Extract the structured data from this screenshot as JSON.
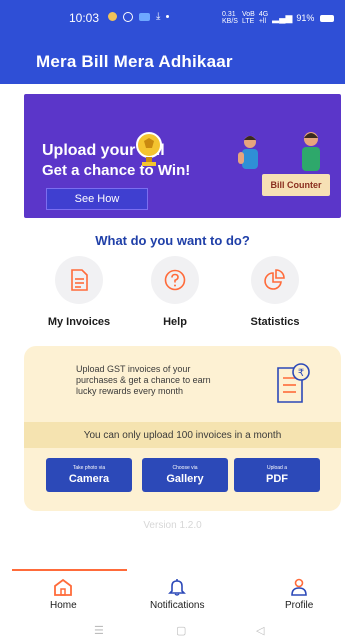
{
  "status_bar": {
    "time": "10:03",
    "network_speed": "0.31\nKB/S",
    "network_type": "VoB\nLTE",
    "signal": "4G\n+ll",
    "battery": "91%"
  },
  "app_bar": {
    "title": "Mera Bill Mera Adhikaar"
  },
  "banner": {
    "line1": "Upload your Bill",
    "line2": "Get a chance to Win!",
    "cta_label": "See How",
    "counter_label": "Bill Counter"
  },
  "section": {
    "question": "What do you want to do?"
  },
  "actions": [
    {
      "label": "My Invoices",
      "icon": "invoice-icon"
    },
    {
      "label": "Help",
      "icon": "help-icon"
    },
    {
      "label": "Statistics",
      "icon": "pie-chart-icon"
    }
  ],
  "upload_card": {
    "description": "Upload GST invoices of your purchases & get a chance to earn lucky rewards every month",
    "limit_text": "You can only upload 100 invoices in a month",
    "buttons": [
      {
        "small": "Take photo via",
        "big": "Camera"
      },
      {
        "small": "Choose via",
        "big": "Gallery"
      },
      {
        "small": "Upload a",
        "big": "PDF"
      }
    ]
  },
  "version": "Version 1.2.0",
  "bottom_nav": {
    "items": [
      {
        "label": "Home",
        "icon": "home-icon",
        "active": true
      },
      {
        "label": "Notifications",
        "icon": "bell-icon",
        "active": false
      },
      {
        "label": "Profile",
        "icon": "profile-icon",
        "active": false
      }
    ]
  },
  "colors": {
    "primary": "#2f4fd6",
    "banner_bg": "#5b36c9",
    "accent": "#ff6b3a",
    "card_bg": "#fdf1d3",
    "button_bg": "#2c49b8"
  }
}
